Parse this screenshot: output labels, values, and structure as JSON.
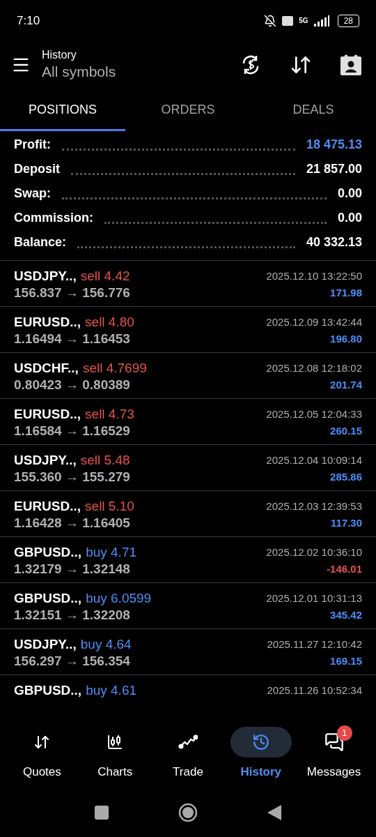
{
  "status_bar": {
    "time": "7:10",
    "network": "5G",
    "battery": "28"
  },
  "header": {
    "title": "History",
    "subtitle": "All symbols"
  },
  "tabs": [
    {
      "label": "POSITIONS",
      "selected": true
    },
    {
      "label": "ORDERS",
      "selected": false
    },
    {
      "label": "DEALS",
      "selected": false
    }
  ],
  "summary": [
    {
      "label": "Profit:",
      "value": "18 475.13",
      "highlight": true
    },
    {
      "label": "Deposit",
      "value": "21 857.00",
      "highlight": false
    },
    {
      "label": "Swap:",
      "value": "0.00",
      "highlight": false
    },
    {
      "label": "Commission:",
      "value": "0.00",
      "highlight": false
    },
    {
      "label": "Balance:",
      "value": "40 332.13",
      "highlight": false
    }
  ],
  "positions": [
    {
      "symbol": "USDJPY..,",
      "kind": "sell",
      "trade": "sell 4.42",
      "prices": "156.837 → 156.776",
      "time": "2025.12.10 13:22:50",
      "profit": "171.98",
      "loss": false
    },
    {
      "symbol": "EURUSD..,",
      "kind": "sell",
      "trade": "sell 4.80",
      "prices": "1.16494 → 1.16453",
      "time": "2025.12.09 13:42:44",
      "profit": "196.80",
      "loss": false
    },
    {
      "symbol": "USDCHF..,",
      "kind": "sell",
      "trade": "sell 4.7699",
      "prices": "0.80423 → 0.80389",
      "time": "2025.12.08 12:18:02",
      "profit": "201.74",
      "loss": false
    },
    {
      "symbol": "EURUSD..,",
      "kind": "sell",
      "trade": "sell 4.73",
      "prices": "1.16584 → 1.16529",
      "time": "2025.12.05 12:04:33",
      "profit": "260.15",
      "loss": false
    },
    {
      "symbol": "USDJPY..,",
      "kind": "sell",
      "trade": "sell 5.48",
      "prices": "155.360 → 155.279",
      "time": "2025.12.04 10:09:14",
      "profit": "285.86",
      "loss": false
    },
    {
      "symbol": "EURUSD..,",
      "kind": "sell",
      "trade": "sell 5.10",
      "prices": "1.16428 → 1.16405",
      "time": "2025.12.03 12:39:53",
      "profit": "117.30",
      "loss": false
    },
    {
      "symbol": "GBPUSD..,",
      "kind": "buy",
      "trade": "buy 4.71",
      "prices": "1.32179 → 1.32148",
      "time": "2025.12.02 10:36:10",
      "profit": "-146.01",
      "loss": true
    },
    {
      "symbol": "GBPUSD..,",
      "kind": "buy",
      "trade": "buy 6.0599",
      "prices": "1.32151 → 1.32208",
      "time": "2025.12.01 10:31:13",
      "profit": "345.42",
      "loss": false
    },
    {
      "symbol": "USDJPY..,",
      "kind": "buy",
      "trade": "buy 4.64",
      "prices": "156.297 → 156.354",
      "time": "2025.11.27 12:10:42",
      "profit": "169.15",
      "loss": false
    },
    {
      "symbol": "GBPUSD..,",
      "kind": "buy",
      "trade": "buy 4.61",
      "time": "2025.11.26 10:52:34"
    }
  ],
  "bottom_nav": [
    {
      "label": "Quotes",
      "kind": "quotes",
      "selected": false
    },
    {
      "label": "Charts",
      "kind": "charts",
      "selected": false
    },
    {
      "label": "Trade",
      "kind": "trade",
      "selected": false
    },
    {
      "label": "History",
      "kind": "history",
      "selected": true
    },
    {
      "label": "Messages",
      "kind": "messages",
      "selected": false,
      "badge": "1"
    }
  ]
}
